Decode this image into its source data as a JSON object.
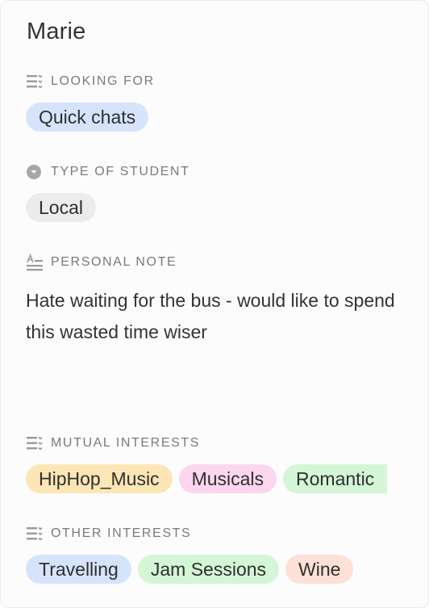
{
  "profile": {
    "name": "Marie"
  },
  "colors": {
    "blue": "#d6e4fb",
    "gray": "#ececec",
    "yellow": "#fde6b6",
    "pink": "#fbd6ee",
    "green": "#d4f5d6",
    "salmon": "#fde0d7"
  },
  "sections": {
    "looking_for": {
      "label": "LOOKING FOR",
      "icon": "multi-select-icon",
      "tags": [
        "Quick chats"
      ]
    },
    "type_of_student": {
      "label": "TYPE OF STUDENT",
      "icon": "single-select-icon",
      "tags": [
        "Local"
      ]
    },
    "personal_note": {
      "label": "PERSONAL NOTE",
      "icon": "long-text-icon",
      "text": "Hate waiting for the bus - would like to spend this wasted time wiser"
    },
    "mutual_interests": {
      "label": "MUTUAL INTERESTS",
      "icon": "multi-select-icon",
      "tags": [
        "HipHop_Music",
        "Musicals",
        "Romantic"
      ]
    },
    "other_interests": {
      "label": "OTHER INTERESTS",
      "icon": "multi-select-icon",
      "tags": [
        "Travelling",
        "Jam Sessions",
        "Wine"
      ]
    }
  }
}
